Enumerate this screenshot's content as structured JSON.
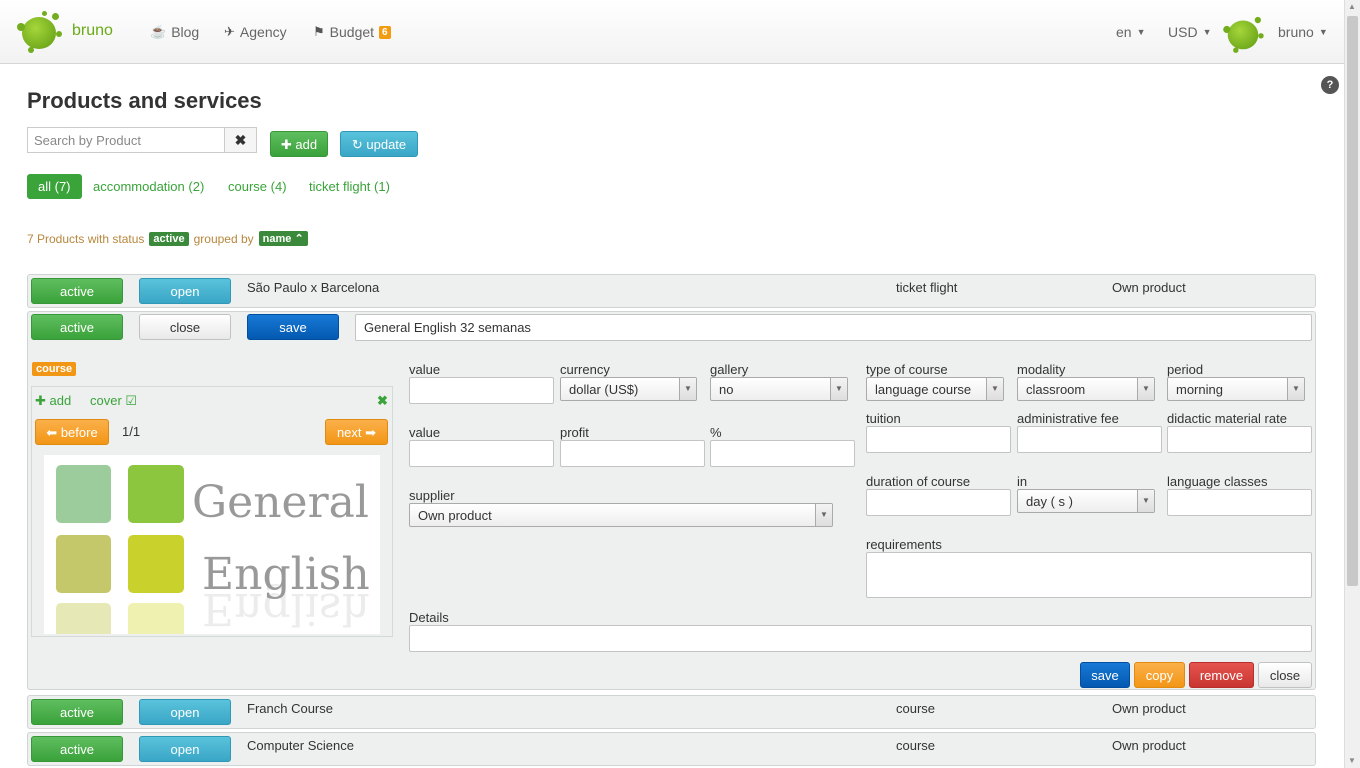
{
  "header": {
    "brand": "bruno",
    "nav": [
      {
        "label": "Blog",
        "icon": "coffee-icon"
      },
      {
        "label": "Agency",
        "icon": "plane-icon"
      },
      {
        "label": "Budget",
        "icon": "flag-icon",
        "badge": "6"
      }
    ],
    "language": "en",
    "currency": "USD",
    "user": "bruno"
  },
  "help": "?",
  "page": {
    "title": "Products and services",
    "search_placeholder": "Search by Product",
    "add_label": "add",
    "update_label": "update"
  },
  "filters": [
    "all (7)",
    "accommodation (2)",
    "course (4)",
    "ticket flight (1)"
  ],
  "status_line": {
    "prefix": "7 Products with status",
    "status": "active",
    "middle": "grouped by",
    "group": "name"
  },
  "products": [
    {
      "status": "active",
      "action": "open",
      "name": "São Paulo x Barcelona",
      "type": "ticket flight",
      "owner": "Own product"
    },
    {
      "status": "active",
      "action": "close",
      "save": "save",
      "name": "General English 32 semanas"
    },
    {
      "status": "active",
      "action": "open",
      "name": "Franch Course",
      "type": "course",
      "owner": "Own product"
    },
    {
      "status": "active",
      "action": "open",
      "name": "Computer Science",
      "type": "course",
      "owner": "Own product"
    }
  ],
  "editor": {
    "category_tag": "course",
    "gallery": {
      "add": "add",
      "cover": "cover",
      "before": "before",
      "counter": "1/1",
      "next": "next",
      "image_text_1": "General",
      "image_text_2": "English"
    },
    "labels": {
      "value": "value",
      "currency": "currency",
      "gallery": "gallery",
      "type_of_course": "type of course",
      "modality": "modality",
      "period": "period",
      "tuition": "tuition",
      "administrative_fee": "administrative fee",
      "didactic_material_rate": "didactic material rate",
      "value2": "value",
      "profit": "profit",
      "percent": "%",
      "supplier": "supplier",
      "duration_of_course": "duration of course",
      "in": "in",
      "language_classes": "language classes",
      "requirements": "requirements",
      "details": "Details"
    },
    "selects": {
      "currency": "dollar (US$)",
      "gallery": "no",
      "type_of_course": "language course",
      "modality": "classroom",
      "period": "morning",
      "supplier": "Own product",
      "in": "day ( s )"
    },
    "buttons": {
      "save": "save",
      "copy": "copy",
      "remove": "remove",
      "close": "close"
    }
  }
}
